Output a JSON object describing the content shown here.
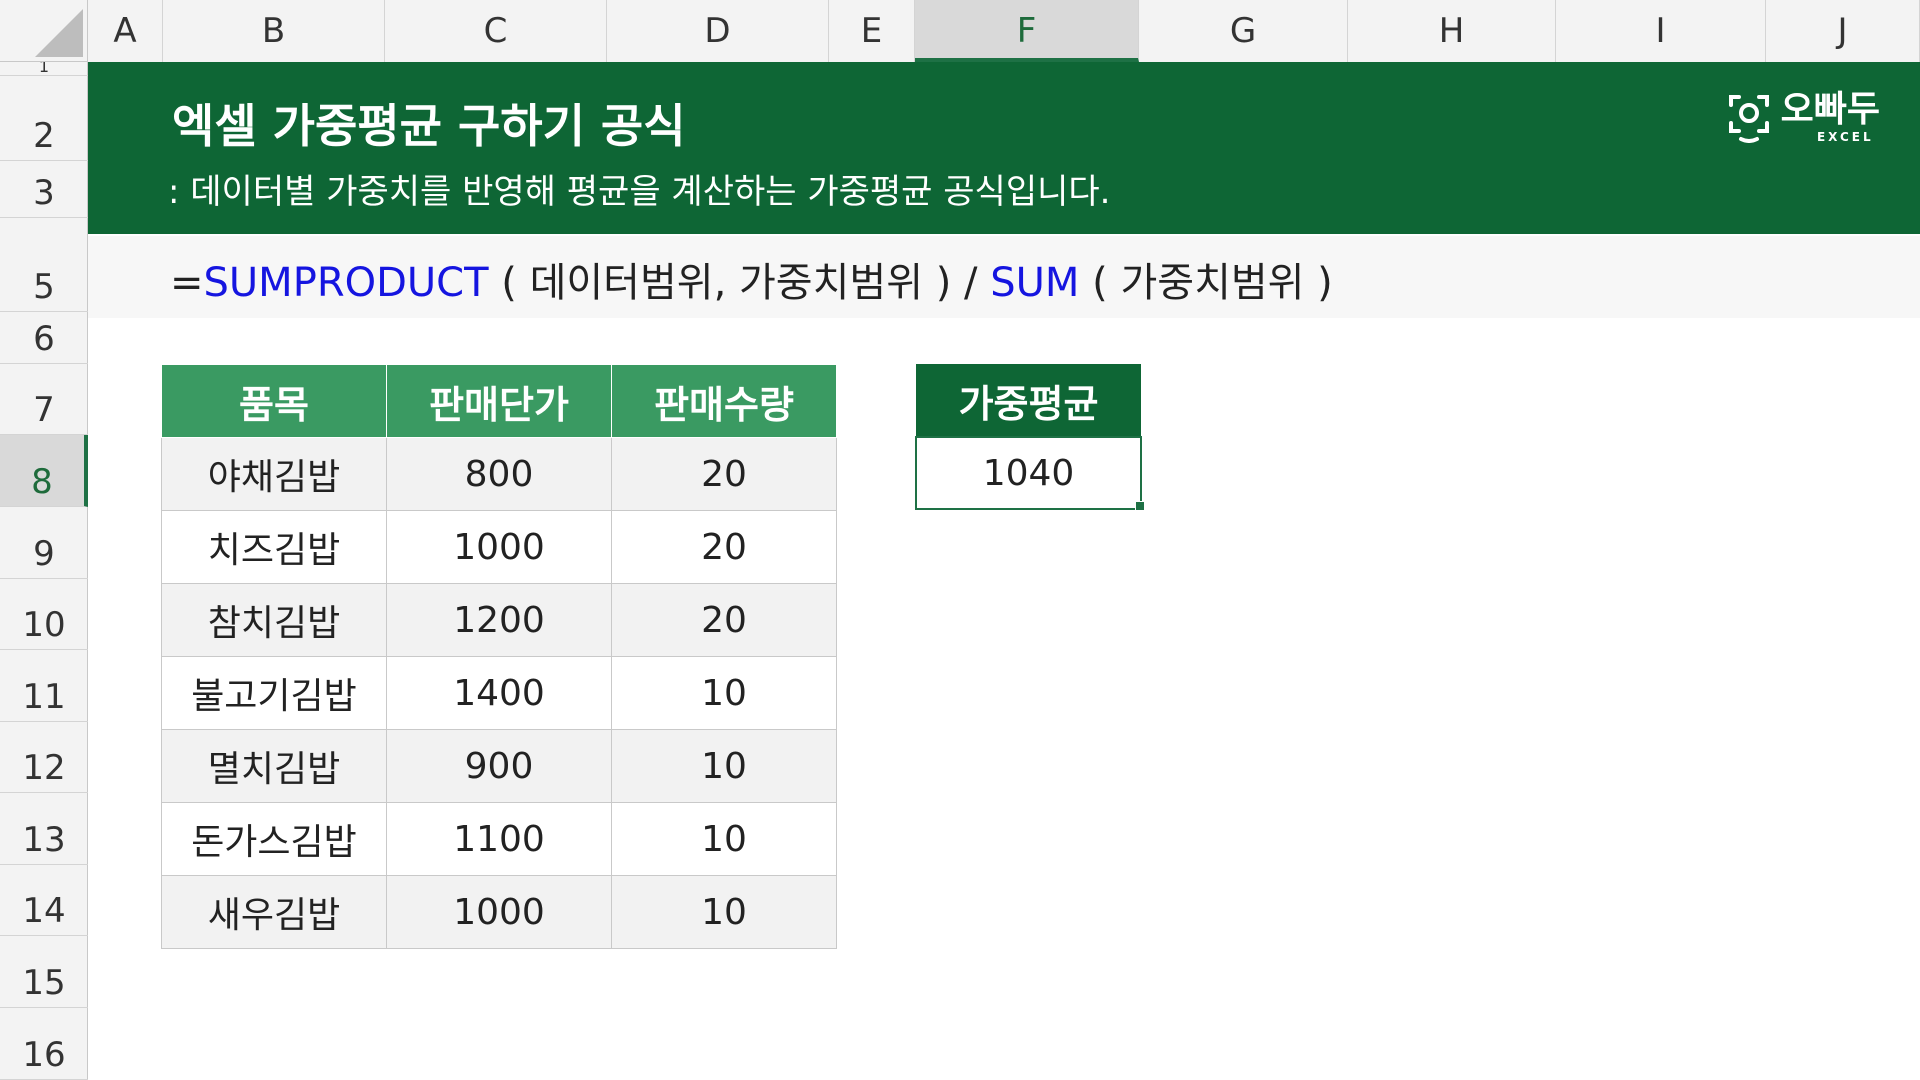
{
  "columns": [
    {
      "label": "A"
    },
    {
      "label": "B"
    },
    {
      "label": "C"
    },
    {
      "label": "D"
    },
    {
      "label": "E"
    },
    {
      "label": "F"
    },
    {
      "label": "G"
    },
    {
      "label": "H"
    },
    {
      "label": "I"
    },
    {
      "label": "J"
    }
  ],
  "rows": [
    {
      "label": "1"
    },
    {
      "label": "2"
    },
    {
      "label": "3"
    },
    {
      "label": "5"
    },
    {
      "label": "6"
    },
    {
      "label": "7"
    },
    {
      "label": "8"
    },
    {
      "label": "9"
    },
    {
      "label": "10"
    },
    {
      "label": "11"
    },
    {
      "label": "12"
    },
    {
      "label": "13"
    },
    {
      "label": "14"
    },
    {
      "label": "15"
    },
    {
      "label": "16"
    }
  ],
  "selected_cell": {
    "column": "F",
    "row": "8"
  },
  "banner": {
    "title": "엑셀 가중평균 구하기 공식",
    "subtitle": ": 데이터별 가중치를 반영해 평균을 계산하는 가중평균 공식입니다.",
    "logo_name": "오빠두",
    "logo_sub": "EXCEL",
    "background": "#0e6635"
  },
  "formula": {
    "eq": "=",
    "fn1": "SUMPRODUCT",
    "args1": " ( 데이터범위, 가중치범위 ) / ",
    "fn2": "SUM",
    "args2": " ( 가중치범위 )"
  },
  "table": {
    "headers": [
      "품목",
      "판매단가",
      "판매수량"
    ],
    "rows": [
      [
        "야채김밥",
        "800",
        "20"
      ],
      [
        "치즈김밥",
        "1000",
        "20"
      ],
      [
        "참치김밥",
        "1200",
        "20"
      ],
      [
        "불고기김밥",
        "1400",
        "10"
      ],
      [
        "멸치김밥",
        "900",
        "10"
      ],
      [
        "돈가스김밥",
        "1100",
        "10"
      ],
      [
        "새우김밥",
        "1000",
        "10"
      ]
    ],
    "header_color": "#3a9a62"
  },
  "result": {
    "header": "가중평균",
    "value": "1040",
    "header_color": "#0e6635"
  }
}
